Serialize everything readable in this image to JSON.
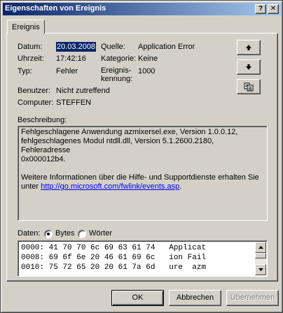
{
  "window": {
    "title": "Eigenschaften von Ereignis",
    "help_glyph": "?",
    "close_glyph": "✕"
  },
  "tab": {
    "label": "Ereignis"
  },
  "fields": {
    "datum_label": "Datum:",
    "datum_value": "20.03.2008",
    "uhrzeit_label": "Uhrzeit:",
    "uhrzeit_value": "17:42:16",
    "typ_label": "Typ:",
    "typ_value": "Fehler",
    "quelle_label": "Quelle:",
    "quelle_value": "Application Error",
    "kategorie_label": "Kategorie:",
    "kategorie_value": "Keine",
    "kennung_label_1": "Ereignis-",
    "kennung_label_2": "kennung:",
    "kennung_value": "1000",
    "benutzer_label": "Benutzer:",
    "benutzer_value": "Nicht zutreffend",
    "computer_label": "Computer:",
    "computer_value": "STEFFEN"
  },
  "side_buttons": [
    {
      "icon": "arrow-up-icon",
      "glyph": "🠉"
    },
    {
      "icon": "arrow-down-icon",
      "glyph": "🠋"
    },
    {
      "icon": "copy-icon"
    }
  ],
  "description": {
    "label": "Beschreibung:",
    "line1": "Fehlgeschlagene Anwendung azmixersel.exe, Version 1.0.0.12,",
    "line2": "fehlgeschlagenes Modul ntdll.dll, Version 5.1.2600.2180, Fehleradresse",
    "line3": "0x000012b4.",
    "line4": "Weitere Informationen über die Hilfe- und Supportdienste erhalten Sie",
    "line5_prefix": "unter ",
    "link": "http://go.microsoft.com/fwlink/events.asp",
    "line5_suffix": "."
  },
  "data_section": {
    "label": "Daten:",
    "option_bytes": "Bytes",
    "option_woerter": "Wörter",
    "selected": "Bytes",
    "rows": [
      "0000: 41 70 70 6c 69 63 61 74   Applicat",
      "0008: 69 6f 6e 20 46 61 69 6c   ion Fail",
      "0010: 75 72 65 20 20 61 7a 6d   ure  azm"
    ]
  },
  "buttons": {
    "ok": "OK",
    "cancel": "Abbrechen",
    "apply": "Übernehmen"
  }
}
